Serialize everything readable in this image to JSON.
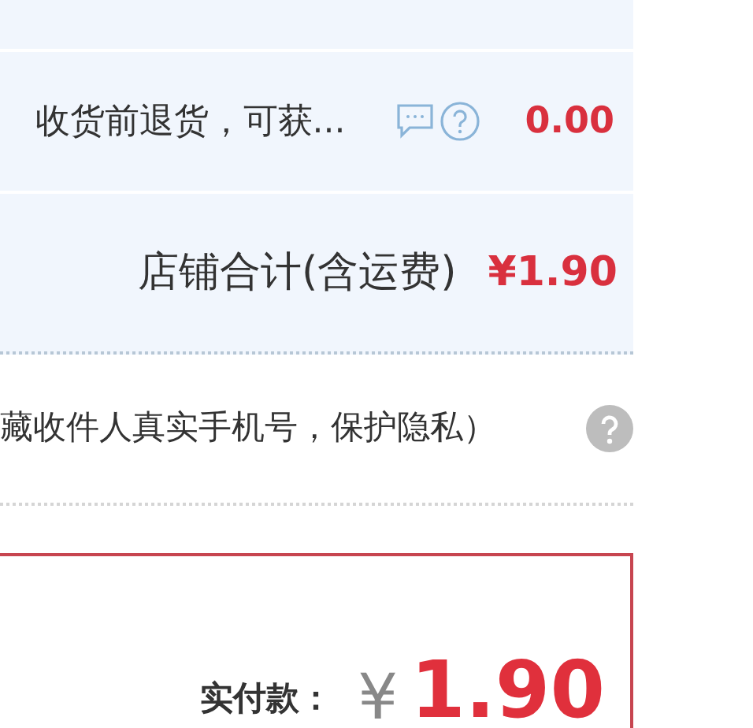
{
  "return_insurance": {
    "text": "收货前退货，可获...",
    "amount": "0.00"
  },
  "store_total": {
    "label": "店铺合计(含运费)",
    "amount": "¥1.90"
  },
  "privacy_note": {
    "text": "藏收件人真实手机号，保护隐私）"
  },
  "payment": {
    "label": "实付款：",
    "currency": "¥",
    "amount": "1.90"
  }
}
